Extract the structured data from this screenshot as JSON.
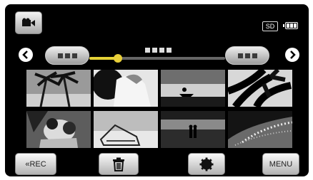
{
  "status": {
    "media": "SD"
  },
  "buttons": {
    "mode": "camera-icon",
    "rec_label": "«REC",
    "menu_label": "MENU"
  },
  "timeline": {
    "position": 0.21
  },
  "thumbnails": [
    {
      "name": "palm-trees"
    },
    {
      "name": "woman-on-beach"
    },
    {
      "name": "boat-at-sunset"
    },
    {
      "name": "palm-leaves"
    },
    {
      "name": "couple-hugging"
    },
    {
      "name": "beach-chair"
    },
    {
      "name": "couple-on-shore"
    },
    {
      "name": "sea-sparkle"
    }
  ]
}
